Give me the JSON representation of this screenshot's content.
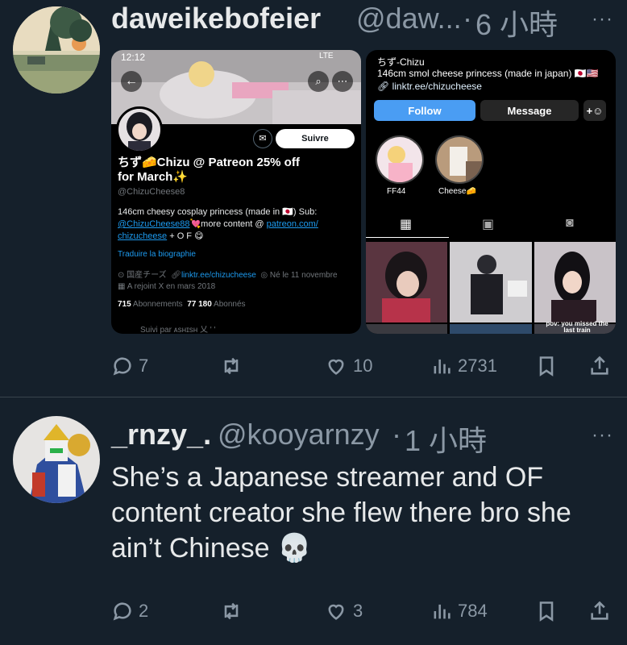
{
  "tweet1": {
    "display_name": "daweikebofeier",
    "handle": "@daw...",
    "sep": "·",
    "time": "6 小時",
    "more": "···",
    "actions": {
      "replies": "7",
      "likes": "10",
      "views": "2731"
    },
    "embed_left": {
      "status_time": "12:12",
      "network": "LTE",
      "follow_label": "Suivre",
      "name_line1": "ちず🧀Chizu @ Patreon 25% off",
      "name_line2": "for March✨",
      "handle": "@ChizuCheese8",
      "bio_line1": "146cm cheesy cosplay princess (made in 🇯🇵) Sub:",
      "bio_line2_link": "@ChizuCheese88",
      "bio_line2_text": "💘more content @",
      "bio_line2_link2": "patreon.com/",
      "bio_line3_link": "chizucheese",
      "bio_line3_text": "+ O F 😋",
      "translate": "Traduire la biographie",
      "location": "国産チーズ",
      "website": "linktr.ee/chizucheese",
      "birthday": "Né le 11 novembre",
      "joined": "A rejoint X en mars 2018",
      "following_count": "715",
      "following_label": "Abonnements",
      "followers_count": "77 180",
      "followers_label": "Abonnés",
      "followed_by": "Suivi par ᴀsʜɪsʜ 乂 ' '"
    },
    "embed_right": {
      "name": "ちず-Chizu",
      "bio": "146cm smol cheese princess (made in japan) 🇯🇵🇺🇸",
      "link": "linktr.ee/chizucheese",
      "follow_btn": "Follow",
      "message_btn": "Message",
      "highlights": [
        "FF44",
        "Cheese🧀"
      ],
      "grid_caption": "pov: you missed the last train"
    }
  },
  "tweet2": {
    "display_name": "_rnzy_.",
    "handle": "@kooyarnzy",
    "sep": "·",
    "time": "1 小時",
    "more": "···",
    "text": "She’s a Japanese streamer and OF content creator she flew there bro she ain’t Chinese 💀",
    "actions": {
      "replies": "2",
      "likes": "3",
      "views": "784"
    }
  },
  "colors": {
    "background": "#15202b",
    "accent": "#1d9bf0",
    "muted": "#8b98a5"
  }
}
